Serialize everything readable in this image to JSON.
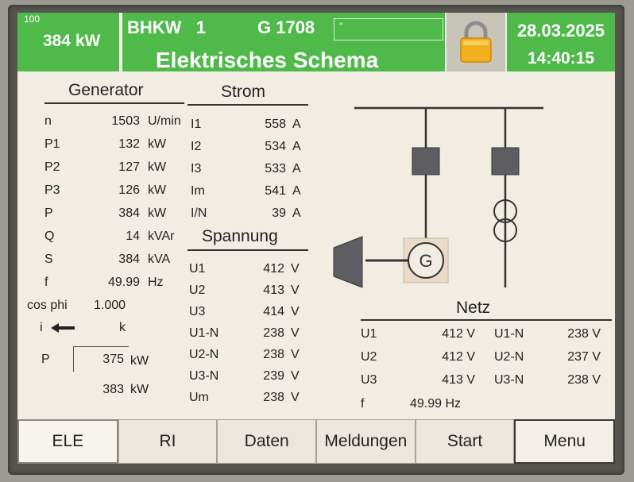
{
  "header": {
    "power_small": "100",
    "power_value": "384 kW",
    "unit": "BHKW   1",
    "generator": "G 1708",
    "field_text": "\"",
    "title": "Elektrisches Schema",
    "date": "28.03.2025",
    "time": "14:40:15",
    "lock_icon": "padlock-icon"
  },
  "generator": {
    "heading": "Generator",
    "rows": [
      {
        "label": "n",
        "value": "1503",
        "unit": "U/min"
      },
      {
        "label": "P1",
        "value": "132",
        "unit": "kW"
      },
      {
        "label": "P2",
        "value": "127",
        "unit": "kW"
      },
      {
        "label": "P3",
        "value": "126",
        "unit": "kW"
      },
      {
        "label": "P",
        "value": "384",
        "unit": "kW"
      },
      {
        "label": "Q",
        "value": "14",
        "unit": "kVAr"
      },
      {
        "label": "S",
        "value": "384",
        "unit": "kVA"
      },
      {
        "label": "f",
        "value": "49.99",
        "unit": "Hz"
      }
    ],
    "cosphi_label": "cos phi",
    "cosphi_value": "1.000",
    "i_label": "i",
    "k_label": "k",
    "setpoint_label": "P",
    "setpoint_value": "375",
    "setpoint_unit": "kW",
    "actual_value": "383",
    "actual_unit": "kW"
  },
  "strom": {
    "heading": "Strom",
    "rows": [
      {
        "label": "I1",
        "value": "558",
        "unit": "A"
      },
      {
        "label": "I2",
        "value": "534",
        "unit": "A"
      },
      {
        "label": "I3",
        "value": "533",
        "unit": "A"
      },
      {
        "label": "Im",
        "value": "541",
        "unit": "A"
      },
      {
        "label": "I/N",
        "value": "39",
        "unit": "A"
      }
    ]
  },
  "spannung": {
    "heading": "Spannung",
    "rows": [
      {
        "label": "U1",
        "value": "412",
        "unit": "V"
      },
      {
        "label": "U2",
        "value": "413",
        "unit": "V"
      },
      {
        "label": "U3",
        "value": "414",
        "unit": "V"
      },
      {
        "label": "U1-N",
        "value": "238",
        "unit": "V"
      },
      {
        "label": "U2-N",
        "value": "238",
        "unit": "V"
      },
      {
        "label": "U3-N",
        "value": "239",
        "unit": "V"
      },
      {
        "label": "Um",
        "value": "238",
        "unit": "V"
      }
    ]
  },
  "netz": {
    "heading": "Netz",
    "rows": [
      {
        "l1": "U1",
        "v1": "412 V",
        "l2": "U1-N",
        "v2": "238 V"
      },
      {
        "l1": "U2",
        "v1": "412 V",
        "l2": "U2-N",
        "v2": "237 V"
      },
      {
        "l1": "U3",
        "v1": "413 V",
        "l2": "U3-N",
        "v2": "238 V"
      }
    ],
    "f_label": "f",
    "f_value": "49.99 Hz"
  },
  "schematic": {
    "generator_symbol": "G"
  },
  "menu": [
    {
      "label": "ELE"
    },
    {
      "label": "RI"
    },
    {
      "label": "Daten"
    },
    {
      "label": "Meldungen"
    },
    {
      "label": "Start"
    },
    {
      "label": "Menu"
    }
  ]
}
